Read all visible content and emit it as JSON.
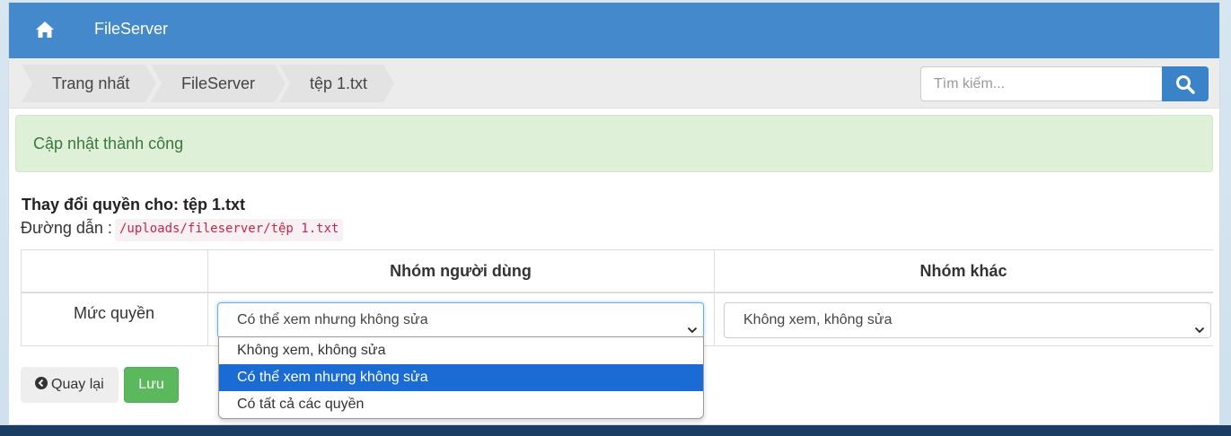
{
  "app": {
    "brand": "FileServer",
    "home_icon": "home-icon"
  },
  "breadcrumb": [
    "Trang nhất",
    "FileServer",
    "tệp 1.txt"
  ],
  "search": {
    "placeholder": "Tìm kiếm...",
    "icon": "search-icon"
  },
  "alert": {
    "message": "Cập nhật thành công"
  },
  "permissions": {
    "title": "Thay đổi quyền cho: tệp 1.txt",
    "path_label": "Đường dẫn :",
    "path_value": "/uploads/fileserver/tệp 1.txt",
    "columns": [
      "",
      "Nhóm người dùng",
      "Nhóm khác"
    ],
    "row_label": "Mức quyền",
    "group_select_value": "Có thể xem nhưng không sửa",
    "other_select_value": "Không xem, không sửa",
    "options": [
      "Không xem, không sửa",
      "Có thể xem nhưng không sửa",
      "Có tất cả các quyền"
    ]
  },
  "buttons": {
    "back": "Quay lại",
    "save": "Lưu"
  },
  "colors": {
    "navbar": "#4489cb",
    "alert_bg": "#dff0d8",
    "save_button": "#5cb85c",
    "selected_option": "#1a6bd3"
  }
}
